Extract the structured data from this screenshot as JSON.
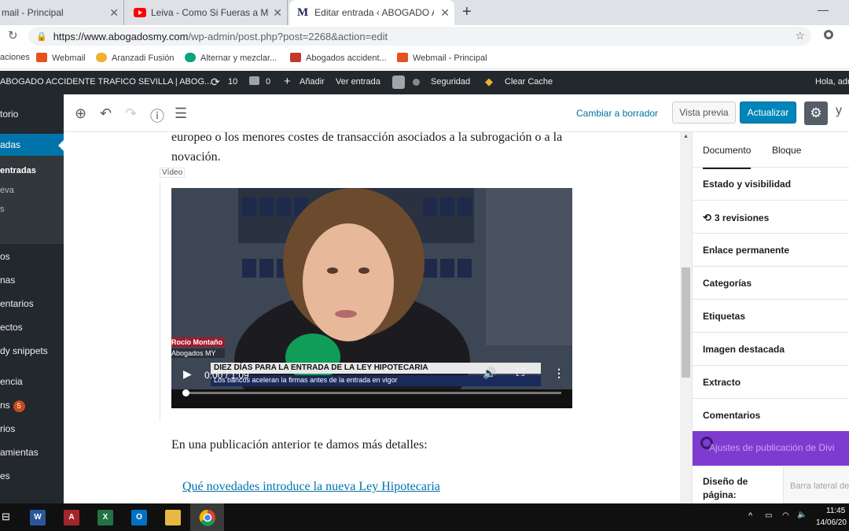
{
  "browser": {
    "tabs": [
      {
        "title": "mail - Principal",
        "state": "inactive"
      },
      {
        "title": "Leiva - Como Si Fueras a Morir M",
        "state": "inactive"
      },
      {
        "title": "Editar entrada ‹ ABOGADO ACCIDE",
        "state": "active"
      }
    ],
    "url_host": "https://www.abogadosmy.com",
    "url_path": "/wp-admin/post.php?post=2268&action=edit",
    "bookmarks": [
      "aciones",
      "Webmail",
      "Aranzadi Fusión",
      "Alternar y mezclar...",
      "Abogados accident...",
      "Webmail - Principal"
    ]
  },
  "adminbar": {
    "site_name": "ABOGADO ACCIDENTE TRAFICO SEVILLA | ABOG...",
    "updates_count": "10",
    "comments_count": "0",
    "add_new": "Añadir",
    "view_post": "Ver entrada",
    "seguridad": "Seguridad",
    "clear_cache": "Clear Cache",
    "greeting": "Hola, adr"
  },
  "sidebar": {
    "items": [
      "torio",
      "adas",
      "entradas",
      "eva",
      "s",
      "os",
      "nas",
      "entarios",
      "ectos",
      "dy snippets",
      "encia",
      "ns",
      "rios",
      "amientas",
      "es"
    ],
    "plugins_badge": "5"
  },
  "toolbar": {
    "cambiar": "Cambiar a borrador",
    "vista_previa": "Vista previa",
    "actualizar": "Actualizar"
  },
  "content": {
    "paragraph1": "europeo o los menores costes de transacción asociados a la subrogación o a la novación.",
    "video_label": "Vídeo",
    "video": {
      "time": "0:00 / 1:09",
      "name_tag": "Rocío Montaño",
      "name_sub": "Abogados MY",
      "headline": "DIEZ DÍAS PARA LA ENTRADA DE LA LEY HIPOTECARIA",
      "subline": "Los bancos aceleran la firmas antes de la entrada en vigor"
    },
    "paragraph2": "En una publicación anterior te damos más detalles:",
    "link": "Qué novedades introduce la nueva Ley Hipotecaria"
  },
  "panel": {
    "tabs": [
      "Documento",
      "Bloque"
    ],
    "rows": [
      "Estado y visibilidad",
      "3 revisiones",
      "Enlace permanente",
      "Categorías",
      "Etiquetas",
      "Imagen destacada",
      "Extracto",
      "Comentarios"
    ],
    "divi": "Ajustes de publicación de Divi",
    "diseno": "Diseño de página:",
    "barra": "Barra lateral de"
  },
  "taskbar": {
    "time": "11:45",
    "date": "14/06/20"
  }
}
